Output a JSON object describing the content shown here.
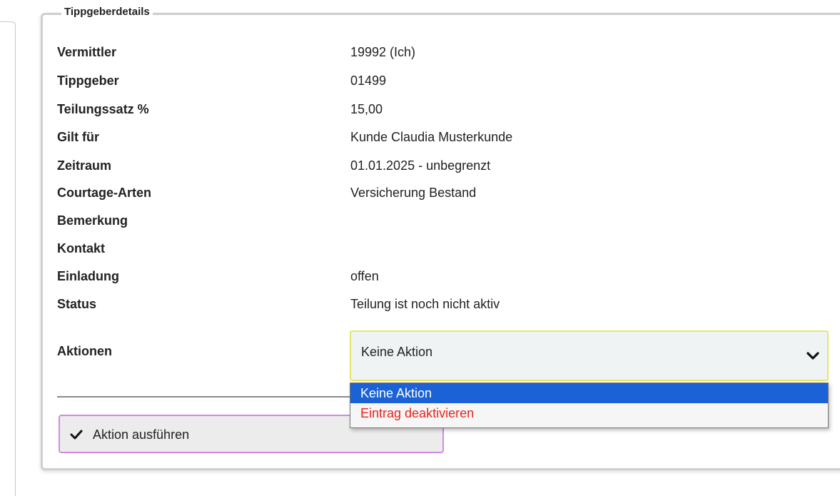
{
  "fieldset": {
    "legend": "Tippgeberdetails"
  },
  "details": [
    {
      "label": "Vermittler",
      "value": "19992 (Ich)"
    },
    {
      "label": "Tippgeber",
      "value": "01499"
    },
    {
      "label": "Teilungssatz %",
      "value": "15,00"
    },
    {
      "label": "Gilt für",
      "value": "Kunde Claudia Musterkunde"
    },
    {
      "label": "Zeitraum",
      "value": "01.01.2025 - unbegrenzt"
    },
    {
      "label": "Courtage-Arten",
      "value": "Versicherung Bestand"
    },
    {
      "label": "Bemerkung",
      "value": ""
    },
    {
      "label": "Kontakt",
      "value": ""
    },
    {
      "label": "Einladung",
      "value": "offen"
    },
    {
      "label": "Status",
      "value": "Teilung ist noch nicht aktiv"
    }
  ],
  "actions": {
    "label": "Aktionen",
    "selected": "Keine Aktion",
    "options": [
      "Keine Aktion",
      "Eintrag deaktivieren"
    ],
    "button_label": "Aktion ausführen"
  },
  "colors": {
    "select_border": "#e4e76b",
    "button_border": "#d28ae0",
    "option_highlight": "#1a62d6",
    "option_danger": "#e8231d"
  }
}
